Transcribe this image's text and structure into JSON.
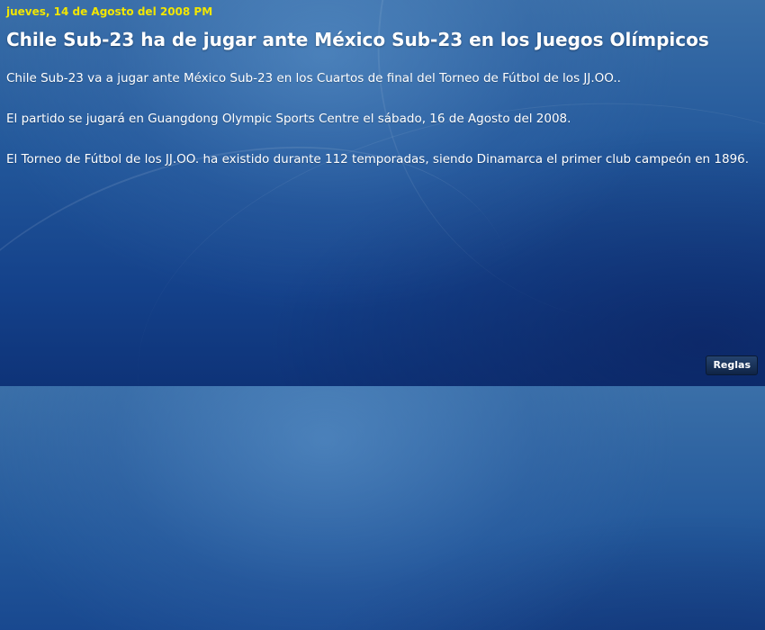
{
  "news": {
    "date": "jueves, 14 de Agosto del 2008 PM",
    "headline": "Chile Sub-23 ha de jugar ante México Sub-23 en los Juegos Olímpicos",
    "paragraphs": [
      "Chile Sub-23 va a jugar ante México Sub-23 en los Cuartos de final del Torneo de Fútbol de los JJ.OO..",
      "El partido se jugará en Guangdong Olympic Sports Centre el sábado, 16 de Agosto del 2008.",
      "El Torneo de Fútbol de los JJ.OO. ha existido durante 112 temporadas, siendo Dinamarca el primer club campeón en 1896."
    ]
  },
  "footer": {
    "rules_label": "Reglas"
  }
}
